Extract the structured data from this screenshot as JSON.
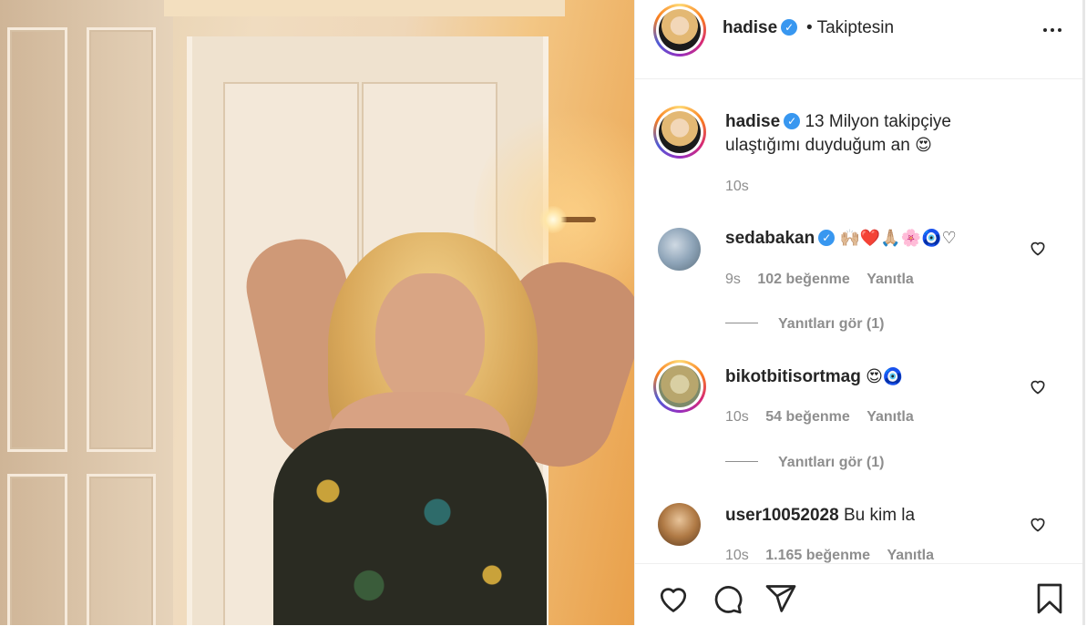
{
  "post": {
    "username": "hadise",
    "follow_status": "Takiptesin"
  },
  "caption": {
    "username": "hadise",
    "text": "13 Milyon takipçiye ulaştığımı duyduğum an",
    "emoji": "😍",
    "time": "10s"
  },
  "comments": [
    {
      "username": "sedabakan",
      "verified": true,
      "text": "🙌🏼❤️🙏🏼🌸🧿♡",
      "time": "9s",
      "likes": "102 beğenme",
      "reply": "Yanıtla",
      "view_replies": "Yanıtları gör (1)"
    },
    {
      "username": "bikotbitisortmag",
      "verified": false,
      "text": "😍🧿",
      "time": "10s",
      "likes": "54 beğenme",
      "reply": "Yanıtla",
      "view_replies": "Yanıtları gör (1)"
    },
    {
      "username": "user10052028",
      "verified": false,
      "text": "Bu kim la",
      "time": "10s",
      "likes": "1.165 beğenme",
      "reply": "Yanıtla"
    }
  ],
  "icons": {
    "verified": "verified-badge-icon",
    "more": "more-options-icon",
    "like": "heart-icon",
    "comment": "comment-icon",
    "share": "share-icon",
    "save": "bookmark-icon"
  },
  "colors": {
    "verified": "#3897f0",
    "secondary_text": "#8e8e8e",
    "primary_text": "#262626"
  }
}
